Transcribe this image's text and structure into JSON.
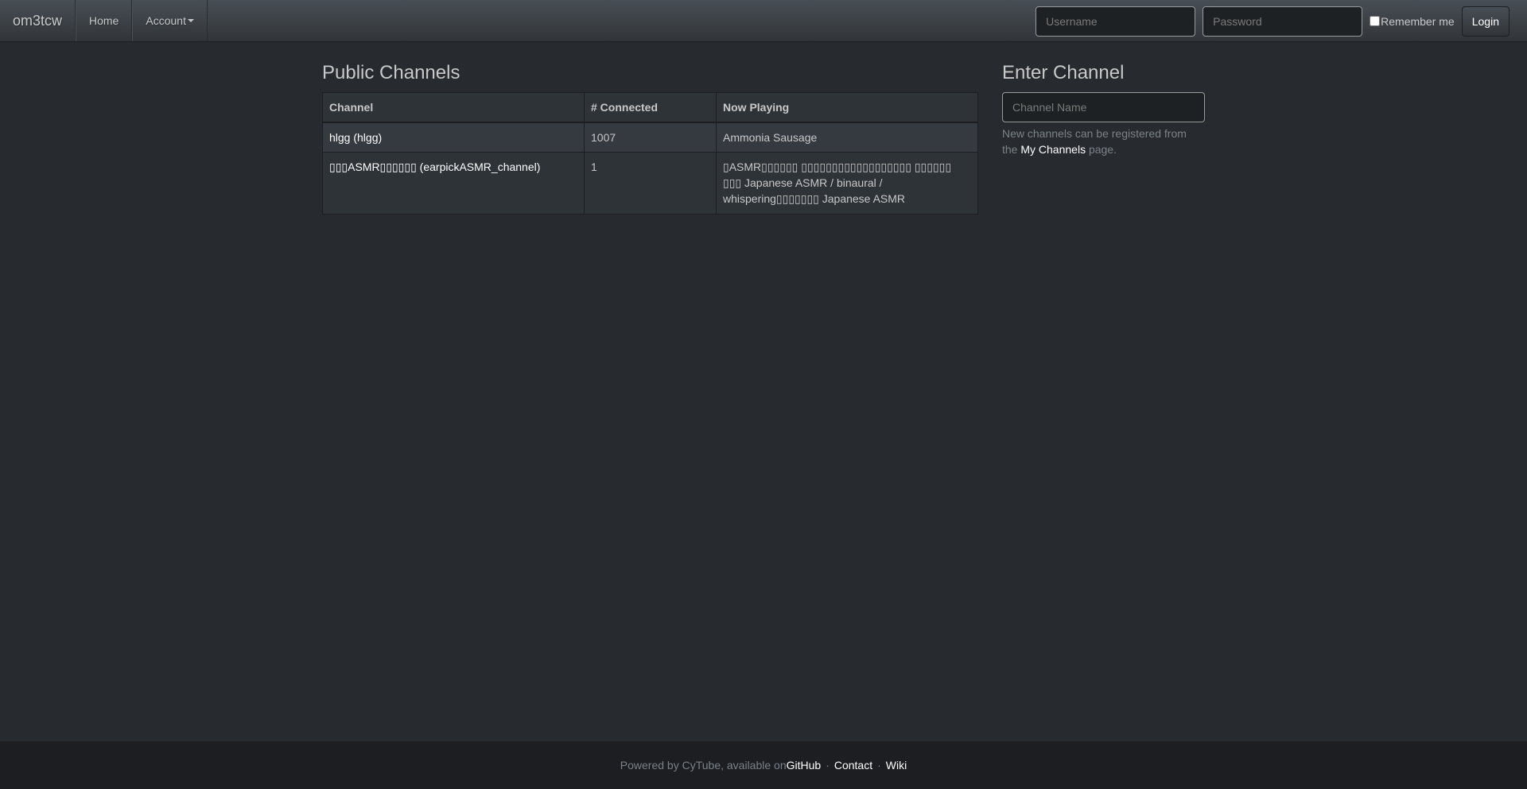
{
  "navbar": {
    "brand": "om3tcw",
    "items": [
      {
        "label": "Home"
      },
      {
        "label": "Account"
      }
    ],
    "login": {
      "username_placeholder": "Username",
      "password_placeholder": "Password",
      "remember_label": "Remember me",
      "login_label": "Login"
    }
  },
  "public_channels": {
    "title": "Public Channels",
    "headers": [
      "Channel",
      "# Connected",
      "Now Playing"
    ],
    "rows": [
      {
        "channel": "hlgg (hlgg)",
        "connected": "1007",
        "now_playing": "Ammonia Sausage"
      },
      {
        "channel": "▯▯▯ASMR▯▯▯▯▯▯ (earpickASMR_channel)",
        "connected": "1",
        "now_playing": "▯ASMR▯▯▯▯▯▯ ▯▯▯▯▯▯▯▯▯▯▯▯▯▯▯▯▯▯ ▯▯▯▯▯▯ ▯▯▯ Japanese ASMR / binaural / whispering▯▯▯▯▯▯▯ Japanese ASMR"
      }
    ]
  },
  "enter_channel": {
    "title": "Enter Channel",
    "placeholder": "Channel Name",
    "help_prefix": "New channels can be registered from the ",
    "help_link": "My Channels",
    "help_suffix": " page."
  },
  "footer": {
    "prefix": "Powered by CyTube, available on ",
    "links": [
      "GitHub",
      "Contact",
      "Wiki"
    ],
    "separator": "·"
  }
}
